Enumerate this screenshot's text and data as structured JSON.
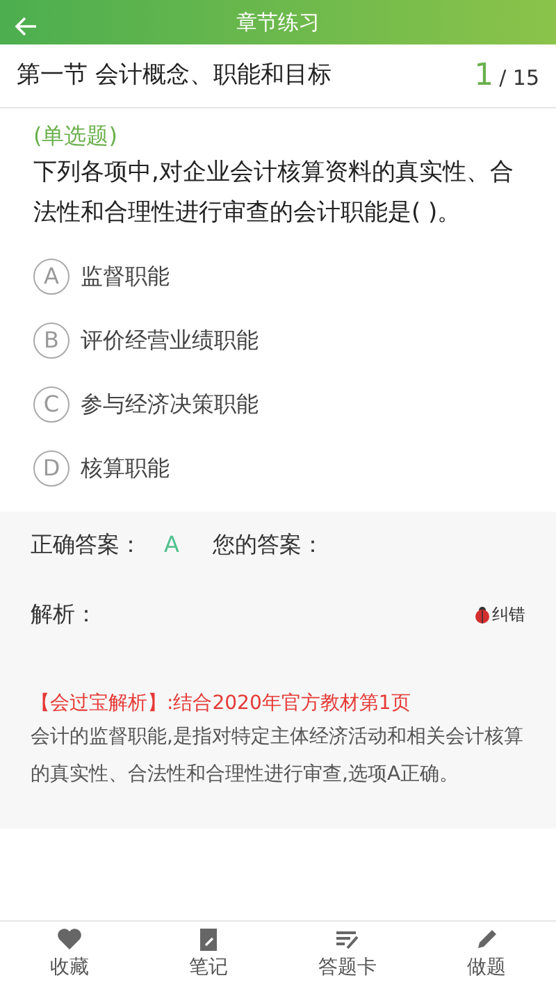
{
  "header": {
    "title": "章节练习"
  },
  "section": {
    "title": "第一节 会计概念、职能和目标",
    "current": "1",
    "total": "/ 15"
  },
  "question": {
    "type_label": "(单选题)",
    "text": "下列各项中,对企业会计核算资料的真实性、合法性和合理性进行审查的会计职能是(      )。"
  },
  "options": [
    {
      "letter": "A",
      "text": "监督职能",
      "selected": false
    },
    {
      "letter": "B",
      "text": "评价经营业绩职能",
      "selected": false
    },
    {
      "letter": "C",
      "text": "参与经济决策职能",
      "selected": false
    },
    {
      "letter": "D",
      "text": "核算职能",
      "selected": false
    }
  ],
  "answer": {
    "correct_label": "正确答案：",
    "correct": "A",
    "yours_label": "您的答案："
  },
  "analysis": {
    "label": "解析：",
    "report": "纠错",
    "source": "【会过宝解析】:结合2020年官方教材第1页",
    "text": "会计的监督职能,是指对特定主体经济活动和相关会计核算的真实性、合法性和合理性进行审查,选项A正确。"
  },
  "bottom_nav": [
    {
      "kind": "heart",
      "label": "收藏"
    },
    {
      "kind": "note",
      "label": "笔记"
    },
    {
      "kind": "sheet",
      "label": "答题卡"
    },
    {
      "kind": "pencil",
      "label": "做题"
    }
  ]
}
